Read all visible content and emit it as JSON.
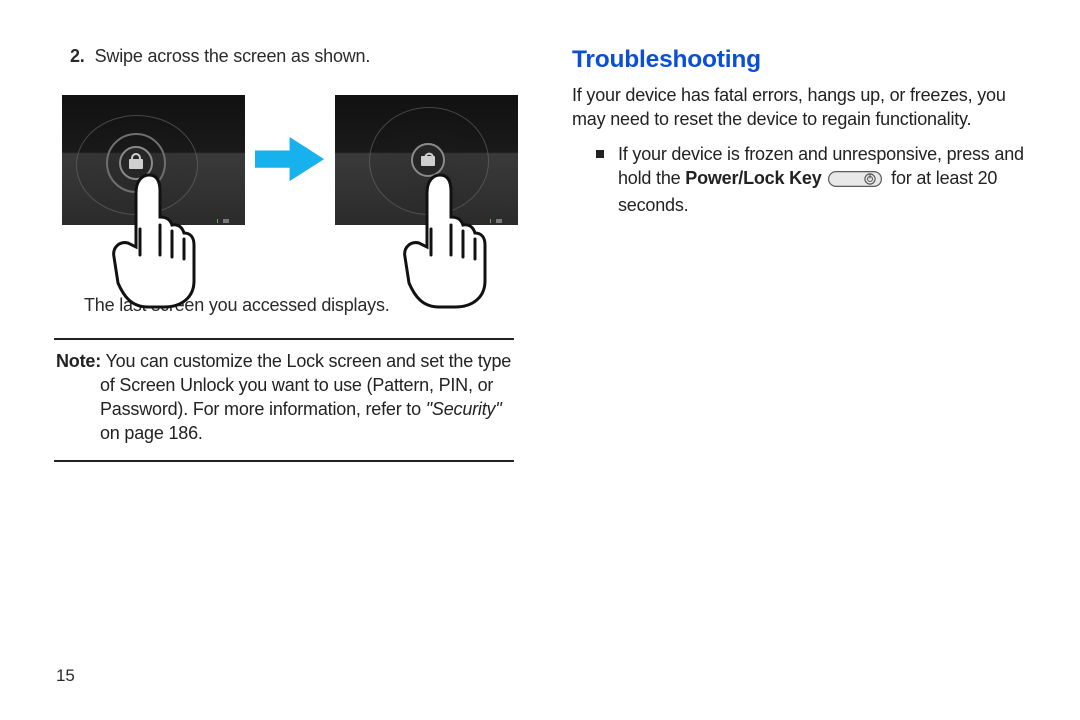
{
  "left": {
    "step_number": "2.",
    "step_text": "Swipe across the screen as shown.",
    "caption": "The last screen you accessed displays.",
    "note_label": "Note:",
    "note_body_1": "You can customize the Lock screen and set the type of Screen Unlock you want to use (Pattern, PIN, or Password). For more information, refer to ",
    "note_ref": "\"Security\"",
    "note_body_2": " on page 186."
  },
  "right": {
    "heading": "Troubleshooting",
    "intro": "If your device has fatal errors, hangs up, or freezes, you may need to reset the device to regain functionality.",
    "bullet_pre": "If your device is frozen and unresponsive, press and hold the ",
    "bullet_bold": "Power/Lock Key",
    "bullet_post": " for at least 20 seconds."
  },
  "page_number": "15",
  "icons": {
    "arrow": "arrow-right-icon",
    "lock_closed": "lock-closed-icon",
    "lock_open": "lock-open-icon",
    "hand": "pointing-hand-icon",
    "power_key": "power-lock-key-icon",
    "bullet": "square-bullet-icon"
  }
}
